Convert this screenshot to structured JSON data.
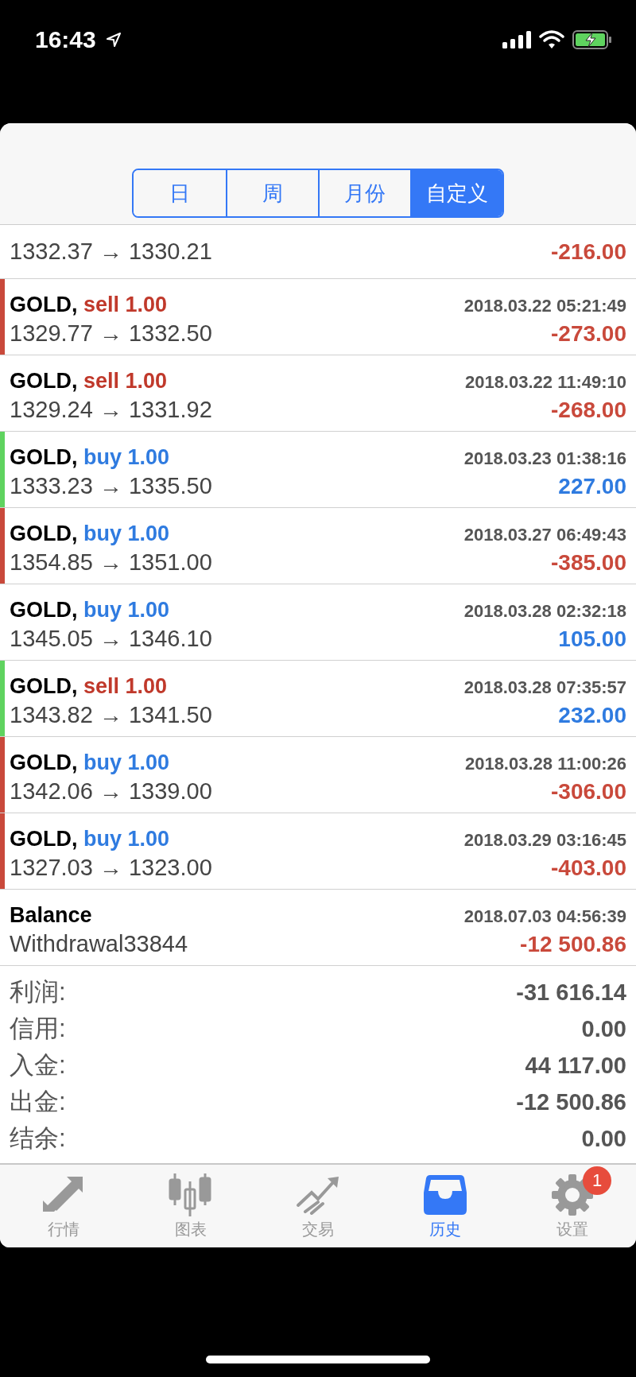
{
  "status_bar": {
    "time": "16:43"
  },
  "segments": [
    {
      "label": "日",
      "selected": false
    },
    {
      "label": "周",
      "selected": false
    },
    {
      "label": "月份",
      "selected": false
    },
    {
      "label": "自定义",
      "selected": true
    }
  ],
  "partial_row": {
    "prices": "1332.37 → 1330.21",
    "amount": "-216.00",
    "profit": false
  },
  "deals": [
    {
      "symbol": "GOLD,",
      "kind": "sell",
      "action": "sell 1.00",
      "time": "2018.03.22 05:21:49",
      "prices": "1329.77 → 1332.50",
      "amount": "-273.00",
      "profit": false,
      "color": "#c9493b"
    },
    {
      "symbol": "GOLD,",
      "kind": "sell",
      "action": "sell 1.00",
      "time": "2018.03.22 11:49:10",
      "prices": "1329.24 → 1331.92",
      "amount": "-268.00",
      "profit": false
    },
    {
      "symbol": "GOLD,",
      "kind": "buy",
      "action": "buy 1.00",
      "time": "2018.03.23 01:38:16",
      "prices": "1333.23 → 1335.50",
      "amount": "227.00",
      "profit": true,
      "color": "#5fd35f"
    },
    {
      "symbol": "GOLD,",
      "kind": "buy",
      "action": "buy 1.00",
      "time": "2018.03.27 06:49:43",
      "prices": "1354.85 → 1351.00",
      "amount": "-385.00",
      "profit": false,
      "color": "#c9493b"
    },
    {
      "symbol": "GOLD,",
      "kind": "buy",
      "action": "buy 1.00",
      "time": "2018.03.28 02:32:18",
      "prices": "1345.05 → 1346.10",
      "amount": "105.00",
      "profit": true
    },
    {
      "symbol": "GOLD,",
      "kind": "sell",
      "action": "sell 1.00",
      "time": "2018.03.28 07:35:57",
      "prices": "1343.82 → 1341.50",
      "amount": "232.00",
      "profit": true,
      "color": "#5fd35f"
    },
    {
      "symbol": "GOLD,",
      "kind": "buy",
      "action": "buy 1.00",
      "time": "2018.03.28 11:00:26",
      "prices": "1342.06 → 1339.00",
      "amount": "-306.00",
      "profit": false,
      "color": "#c9493b"
    },
    {
      "symbol": "GOLD,",
      "kind": "buy",
      "action": "buy 1.00",
      "time": "2018.03.29 03:16:45",
      "prices": "1327.03 → 1323.00",
      "amount": "-403.00",
      "profit": false,
      "color": "#c9493b"
    }
  ],
  "balance": {
    "title": "Balance",
    "time": "2018.07.03 04:56:39",
    "comment": "Withdrawal33844",
    "amount": "-12 500.86",
    "profit": false
  },
  "summary": [
    {
      "label": "利润:",
      "value": "-31 616.14"
    },
    {
      "label": "信用:",
      "value": "0.00"
    },
    {
      "label": "入金:",
      "value": "44 117.00"
    },
    {
      "label": "出金:",
      "value": "-12 500.86"
    },
    {
      "label": "结余:",
      "value": "0.00"
    }
  ],
  "tabs": [
    {
      "label": "行情",
      "kind": "quotes",
      "selected": false
    },
    {
      "label": "图表",
      "kind": "chart",
      "selected": false
    },
    {
      "label": "交易",
      "kind": "trade",
      "selected": false
    },
    {
      "label": "历史",
      "kind": "history",
      "selected": true
    },
    {
      "label": "设置",
      "kind": "settings",
      "selected": false,
      "badge": "1"
    }
  ]
}
